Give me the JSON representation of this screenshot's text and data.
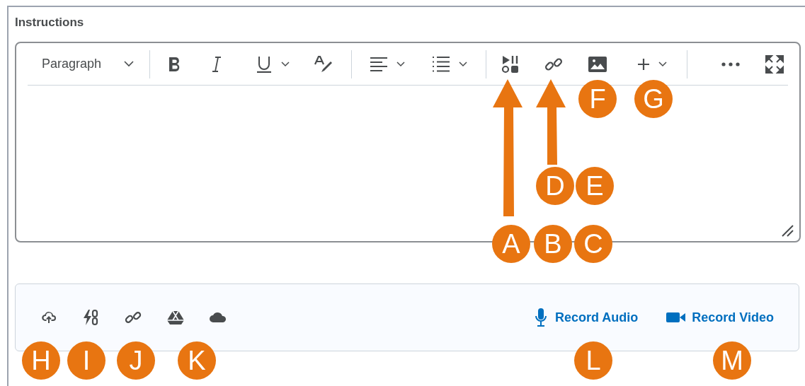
{
  "label": "Instructions",
  "toolbar": {
    "block_format": "Paragraph"
  },
  "attachments": {
    "record_audio": "Record Audio",
    "record_video": "Record Video"
  },
  "callouts": [
    {
      "label": "F"
    },
    {
      "label": "G"
    },
    {
      "label": "D"
    },
    {
      "label": "E"
    },
    {
      "label": "A"
    },
    {
      "label": "B"
    },
    {
      "label": "C"
    },
    {
      "label": "H"
    },
    {
      "label": "I"
    },
    {
      "label": "J"
    },
    {
      "label": "K"
    },
    {
      "label": "L"
    },
    {
      "label": "M"
    }
  ]
}
